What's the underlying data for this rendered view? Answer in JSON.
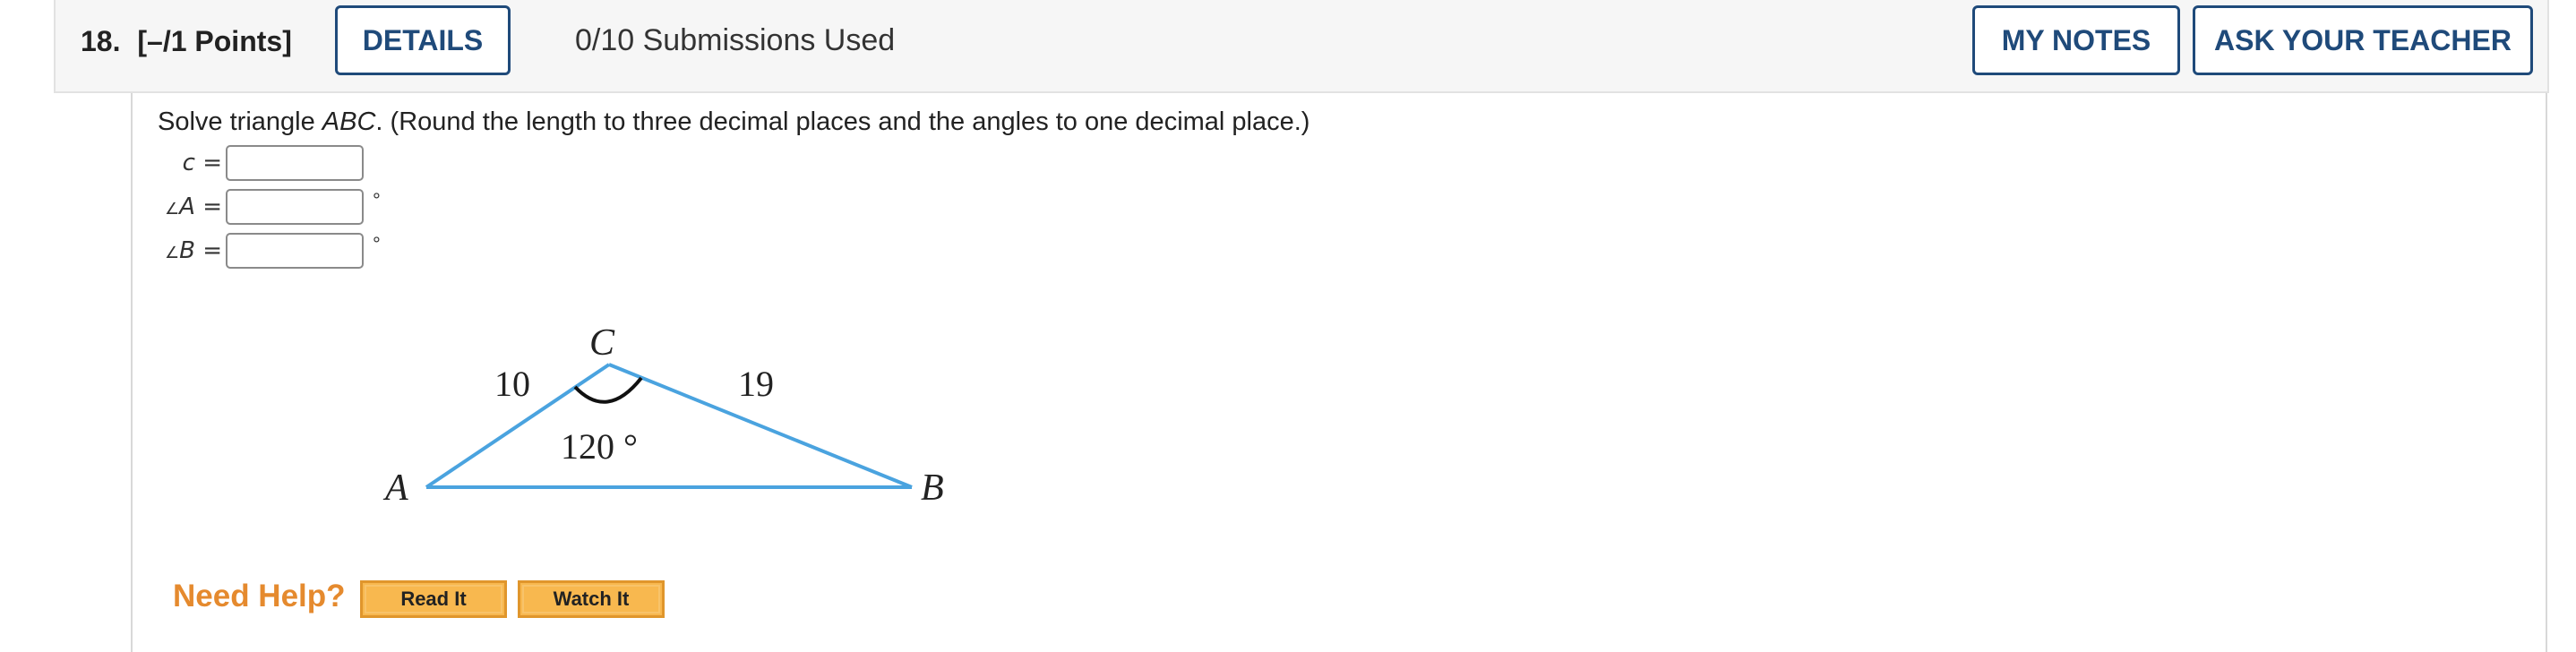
{
  "header": {
    "question_number": "18.",
    "points": "[–/1 Points]",
    "details_label": "DETAILS",
    "submissions": "0/10 Submissions Used",
    "my_notes_label": "MY NOTES",
    "ask_teacher_label": "ASK YOUR TEACHER"
  },
  "question": {
    "prompt_pre": "Solve triangle ",
    "prompt_italic": "ABC",
    "prompt_post": ". (Round the length to three decimal places and the angles to one decimal place.)",
    "fields": [
      {
        "angle_symbol": "",
        "var": "c",
        "suffix": ""
      },
      {
        "angle_symbol": "∠",
        "var": "A",
        "suffix": "°"
      },
      {
        "angle_symbol": "∠",
        "var": "B",
        "suffix": "°"
      }
    ],
    "equals": "="
  },
  "figure": {
    "vertex_a": "A",
    "vertex_b": "B",
    "vertex_c": "C",
    "side_ac": "10",
    "side_cb": "19",
    "angle_c": "120 °",
    "line_color": "#4aa3df"
  },
  "help": {
    "need_help": "Need Help?",
    "read_it": "Read It",
    "watch_it": "Watch It"
  }
}
